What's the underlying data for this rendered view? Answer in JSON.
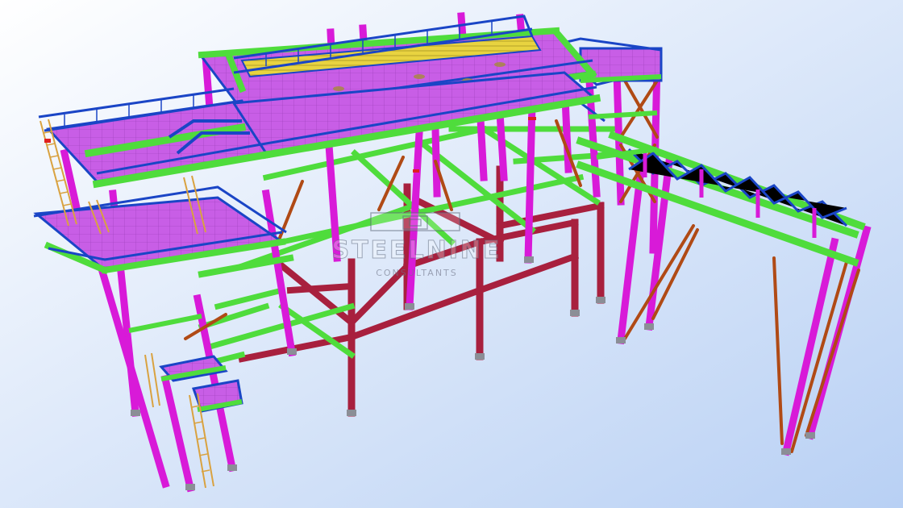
{
  "watermark": {
    "title": "STEELNINE",
    "subtitle": "CONSULTANTS"
  },
  "colors": {
    "background_top": "#ffffff",
    "background_bottom": "#b8d0f4",
    "column_magenta": "#d81ad8",
    "column_red": "#a8203e",
    "beam_green": "#4fdc3c",
    "rail_blue": "#1a45c6",
    "floor_plate": "#c85ee6",
    "bracing_brown": "#b04a15",
    "grating_yellow": "#e8d340",
    "ladder_orange": "#d9a240"
  }
}
